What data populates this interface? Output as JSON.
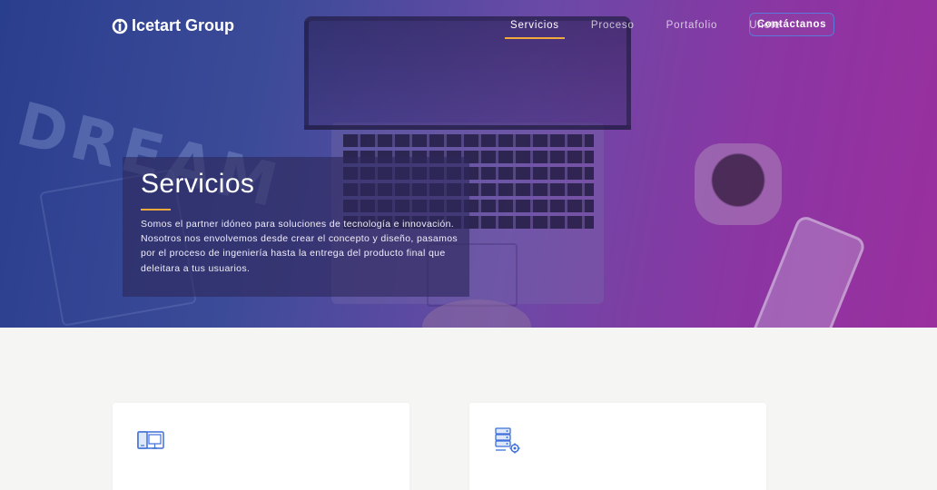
{
  "brand": {
    "name": "Icetart Group",
    "icon": "brand-logo-icon"
  },
  "nav": {
    "items": [
      {
        "label": "Servicios",
        "active": true
      },
      {
        "label": "Proceso",
        "active": false
      },
      {
        "label": "Portafolio",
        "active": false
      },
      {
        "label": "Unete",
        "active": false
      }
    ],
    "cta_label": "Contáctanos"
  },
  "hero": {
    "title": "Servicios",
    "description": "Somos el partner idóneo para soluciones de tecnología e innovación. Nosotros nos envolvemos desde crear el concepto y diseño, pasamos por el proceso de ingeniería hasta la entrega del producto final que deleitara a tus usuarios.",
    "background_text": "DREAM"
  },
  "cards": [
    {
      "icon": "devices-icon"
    },
    {
      "icon": "server-gear-icon"
    }
  ],
  "colors": {
    "accent": "#f0a93a",
    "hero_gradient_start": "#2a3e8e",
    "hero_gradient_end": "#9a2f9e",
    "cta_border": "#5b79d8",
    "icon_blue": "#3f6fd8",
    "page_bg": "#f5f5f3"
  }
}
